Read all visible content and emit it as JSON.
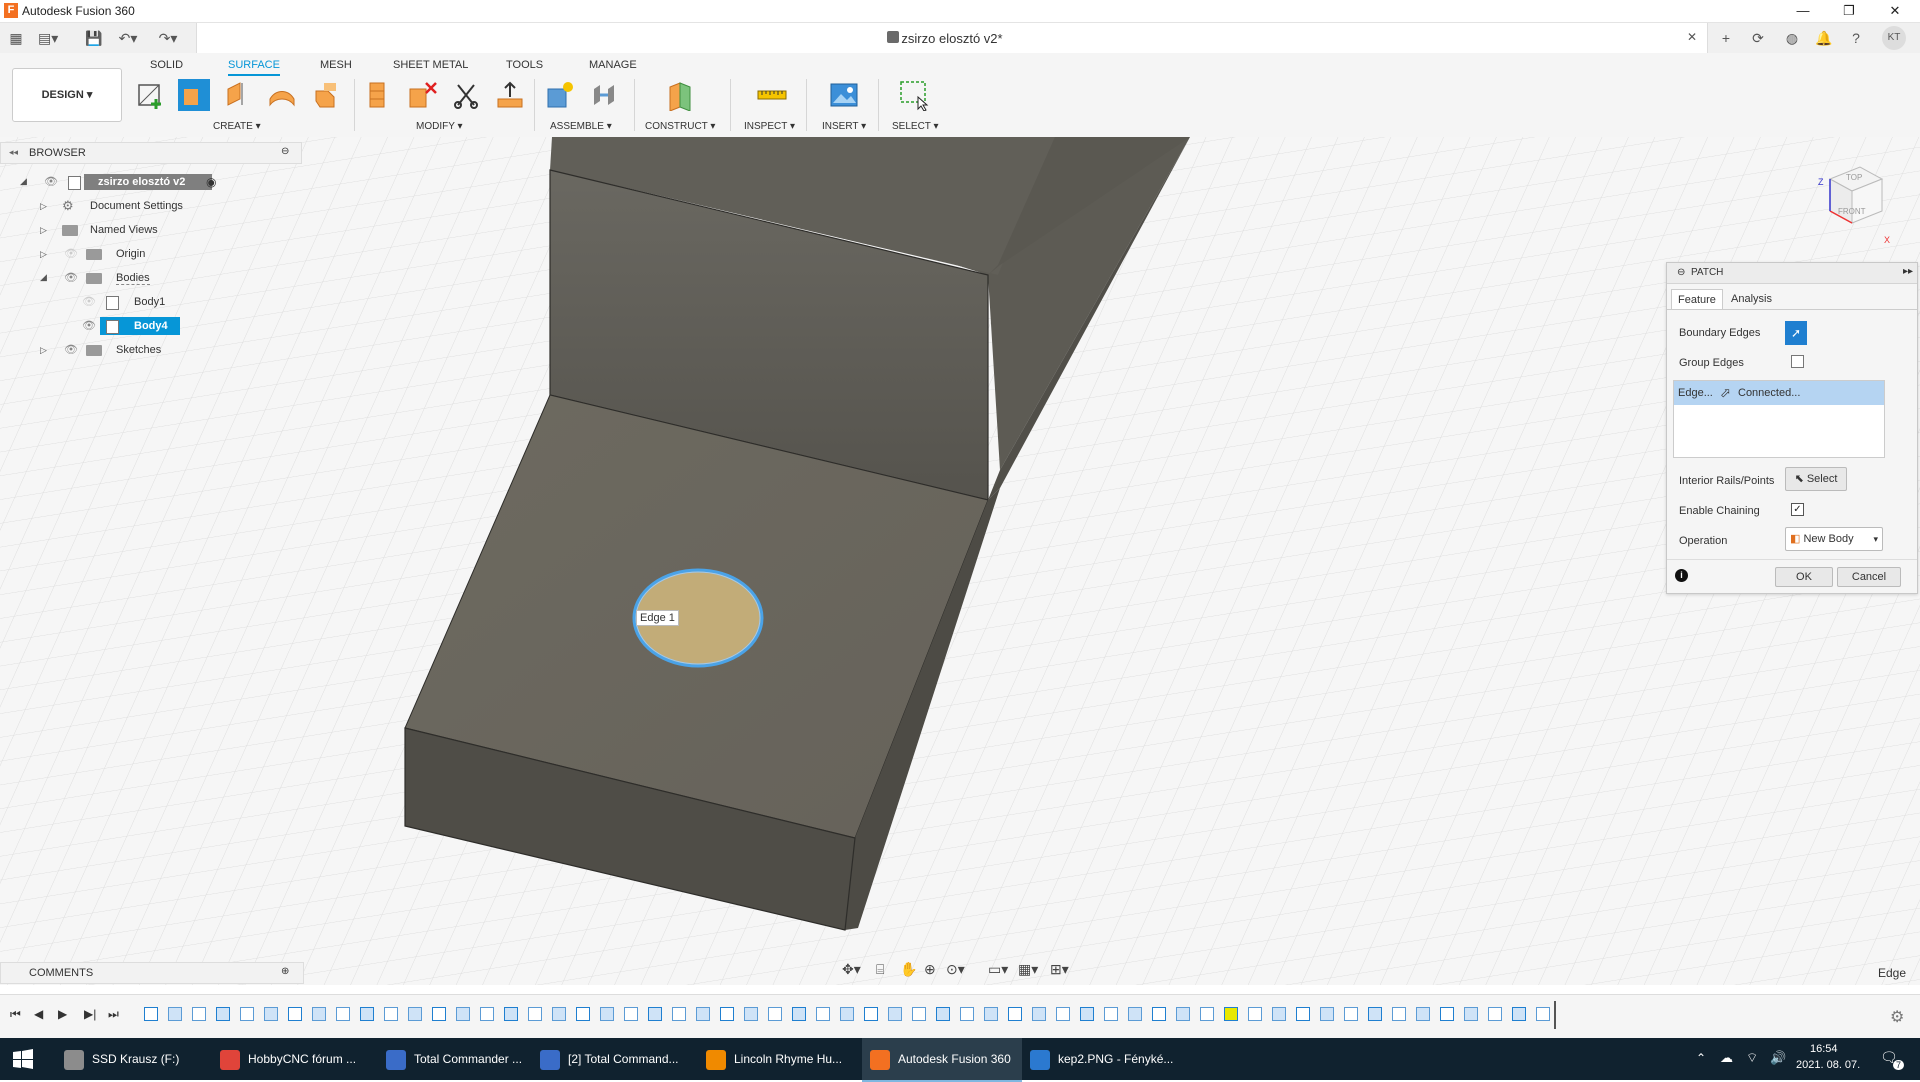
{
  "window": {
    "title": "Autodesk Fusion 360",
    "min": "—",
    "max": "❐",
    "close": "✕"
  },
  "document": {
    "title": "zsirzo elosztó v2*",
    "close": "✕"
  },
  "user_initials": "KT",
  "ribbon": {
    "tabs": [
      "SOLID",
      "SURFACE",
      "MESH",
      "SHEET METAL",
      "TOOLS",
      "MANAGE"
    ],
    "active_tab": "SURFACE",
    "workspace": "DESIGN ▾",
    "groups": [
      "CREATE ▾",
      "MODIFY ▾",
      "ASSEMBLE ▾",
      "CONSTRUCT ▾",
      "INSPECT ▾",
      "INSERT ▾",
      "SELECT ▾"
    ]
  },
  "browser": {
    "title": "BROWSER",
    "items": [
      {
        "label": "zsirzo elosztó v2"
      },
      {
        "label": "Document Settings"
      },
      {
        "label": "Named Views"
      },
      {
        "label": "Origin"
      },
      {
        "label": "Bodies"
      },
      {
        "label": "Body1"
      },
      {
        "label": "Body4"
      },
      {
        "label": "Sketches"
      }
    ]
  },
  "viewcube": {
    "top": "TOP",
    "front": "FRONT",
    "z": "Z",
    "x": "X"
  },
  "canvas": {
    "edge_label": "Edge 1"
  },
  "patch": {
    "title": "PATCH",
    "tabs": [
      "Feature",
      "Analysis"
    ],
    "boundary_edges": "Boundary Edges",
    "group_edges": "Group Edges",
    "group_edges_checked": false,
    "sel_col1": "Edge...",
    "sel_col2": "Connected...",
    "interior_rails": "Interior Rails/Points",
    "select_btn": "Select",
    "enable_chaining": "Enable Chaining",
    "enable_chaining_checked": true,
    "operation": "Operation",
    "operation_value": "New Body",
    "ok": "OK",
    "cancel": "Cancel"
  },
  "comments": {
    "title": "COMMENTS"
  },
  "status": {
    "selection": "Edge"
  },
  "taskbar": {
    "items": [
      {
        "label": "SSD Krausz (F:)",
        "color": "#8c8c8c"
      },
      {
        "label": "HobbyCNC fórum ...",
        "color": "#e0443a"
      },
      {
        "label": "Total Commander ...",
        "color": "#3a6cc8"
      },
      {
        "label": "[2] Total Command...",
        "color": "#3a6cc8"
      },
      {
        "label": "Lincoln Rhyme Hu...",
        "color": "#f08a00"
      },
      {
        "label": "Autodesk Fusion 360",
        "color": "#f37021"
      },
      {
        "label": "kep2.PNG - Fényké...",
        "color": "#2b79d0"
      }
    ],
    "active": "Autodesk Fusion 360",
    "time": "16:54",
    "date": "2021. 08. 07.",
    "notif_count": "7"
  },
  "colors": {
    "accent": "#0696d7",
    "body_dark": "#5f5b52",
    "patch_face": "#c2ac78",
    "taskbar": "#10222f"
  }
}
